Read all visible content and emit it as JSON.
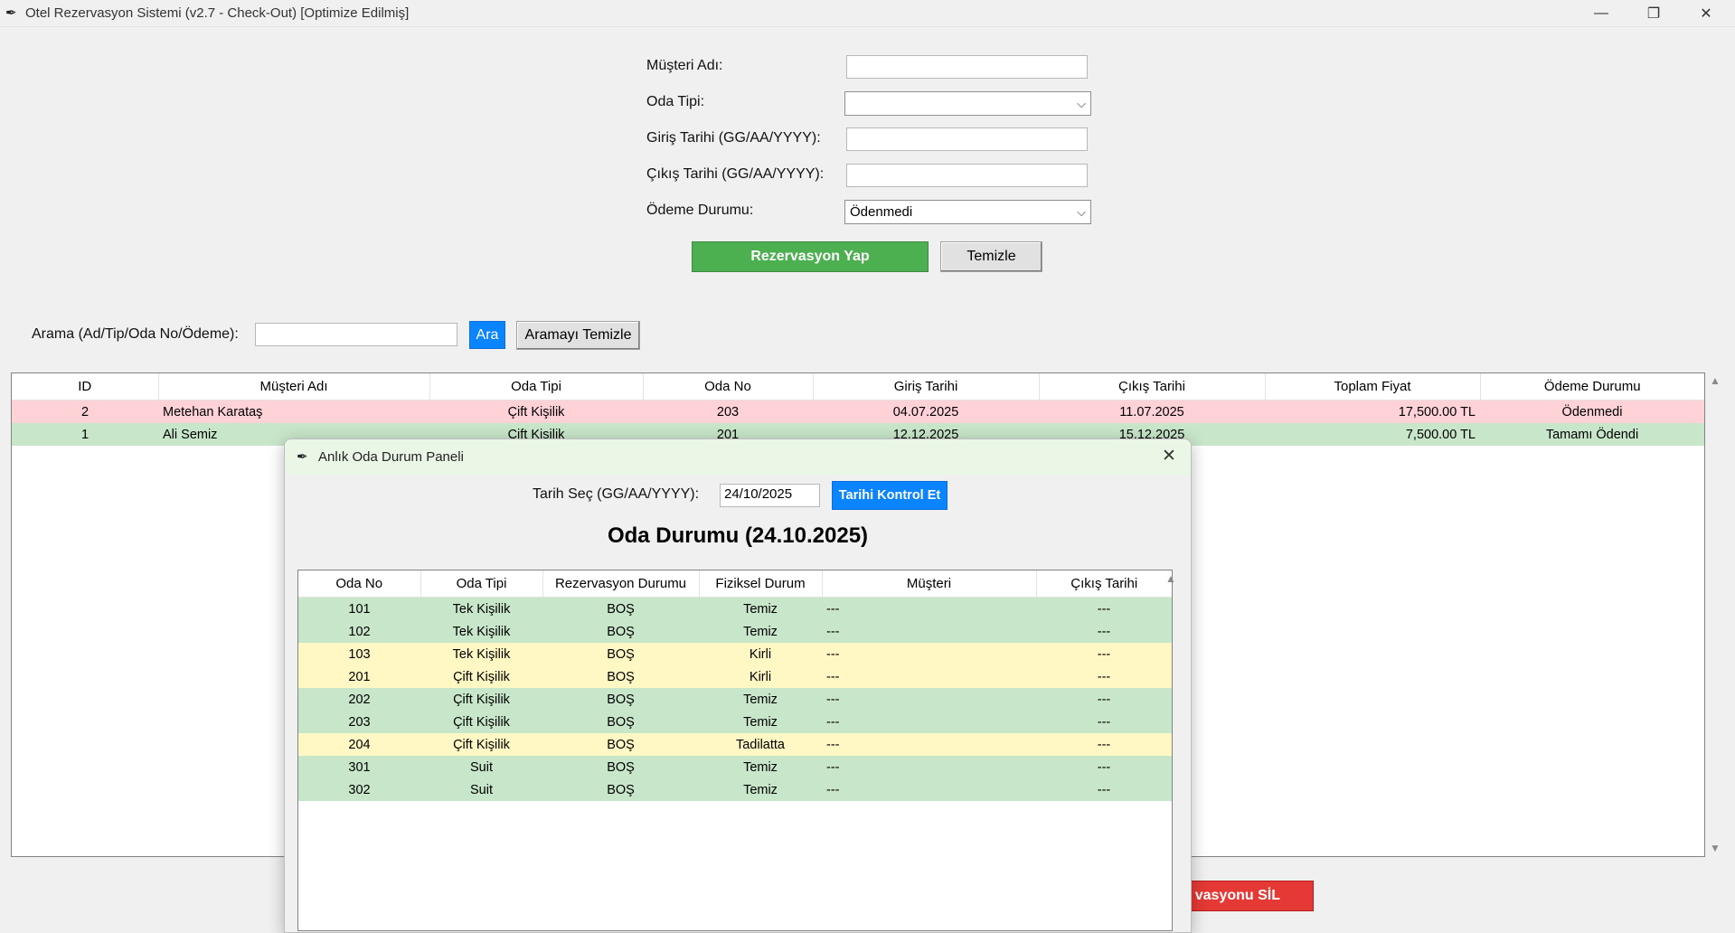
{
  "window": {
    "title": "Otel Rezervasyon Sistemi (v2.7 - Check-Out) [Optimize Edilmiş]",
    "minimize_glyph": "—",
    "maximize_glyph": "❐",
    "close_glyph": "✕"
  },
  "form": {
    "customer_name_label": "Müşteri Adı:",
    "customer_name_value": "",
    "room_type_label": "Oda Tipi:",
    "room_type_value": "",
    "checkin_label": "Giriş Tarihi (GG/AA/YYYY):",
    "checkin_value": "",
    "checkout_label": "Çıkış Tarihi (GG/AA/YYYY):",
    "checkout_value": "",
    "payment_label": "Ödeme Durumu:",
    "payment_value": "Ödenmedi",
    "reserve_button": "Rezervasyon Yap",
    "clear_button": "Temizle"
  },
  "search": {
    "label": "Arama (Ad/Tip/Oda No/Ödeme):",
    "value": "",
    "search_button": "Ara",
    "clear_button": "Aramayı Temizle"
  },
  "reservations": {
    "headers": [
      "ID",
      "Müşteri Adı",
      "Oda Tipi",
      "Oda No",
      "Giriş Tarihi",
      "Çıkış Tarihi",
      "Toplam Fiyat",
      "Ödeme Durumu"
    ],
    "rows": [
      {
        "id": "2",
        "name": "Metehan Karataş",
        "type": "Çift Kişilik",
        "room": "203",
        "checkin": "04.07.2025",
        "checkout": "11.07.2025",
        "price": "17,500.00 TL",
        "payment": "Ödenmedi",
        "status": "unpaid"
      },
      {
        "id": "1",
        "name": "Ali Semiz",
        "type": "Çift Kişilik",
        "room": "201",
        "checkin": "12.12.2025",
        "checkout": "15.12.2025",
        "price": "7,500.00 TL",
        "payment": "Tamamı Ödendi",
        "status": "paid"
      }
    ]
  },
  "delete_button": "vasyonu SİL",
  "colors": {
    "accent_green": "#4caf50",
    "accent_blue": "#0a84ff",
    "delete_red": "#e53935",
    "row_pink": "#ffd2d8",
    "row_green": "#c8e6c9",
    "row_yellow": "#fff7c4"
  },
  "panel": {
    "title": "Anlık Oda Durum Paneli",
    "date_label": "Tarih Seç (GG/AA/YYYY):",
    "date_value": "24/10/2025",
    "check_button": "Tarihi Kontrol Et",
    "heading": "Oda Durumu (24.10.2025)",
    "headers": [
      "Oda No",
      "Oda Tipi",
      "Rezervasyon Durumu",
      "Fiziksel Durum",
      "Müşteri",
      "Çıkış Tarihi"
    ],
    "rows": [
      {
        "room": "101",
        "type": "Tek Kişilik",
        "res": "BOŞ",
        "phys": "Temiz",
        "customer": "---",
        "checkout": "---",
        "color": "green"
      },
      {
        "room": "102",
        "type": "Tek Kişilik",
        "res": "BOŞ",
        "phys": "Temiz",
        "customer": "---",
        "checkout": "---",
        "color": "green"
      },
      {
        "room": "103",
        "type": "Tek Kişilik",
        "res": "BOŞ",
        "phys": "Kirli",
        "customer": "---",
        "checkout": "---",
        "color": "yellow"
      },
      {
        "room": "201",
        "type": "Çift Kişilik",
        "res": "BOŞ",
        "phys": "Kirli",
        "customer": "---",
        "checkout": "---",
        "color": "yellow"
      },
      {
        "room": "202",
        "type": "Çift Kişilik",
        "res": "BOŞ",
        "phys": "Temiz",
        "customer": "---",
        "checkout": "---",
        "color": "green"
      },
      {
        "room": "203",
        "type": "Çift Kişilik",
        "res": "BOŞ",
        "phys": "Temiz",
        "customer": "---",
        "checkout": "---",
        "color": "green"
      },
      {
        "room": "204",
        "type": "Çift Kişilik",
        "res": "BOŞ",
        "phys": "Tadilatta",
        "customer": "---",
        "checkout": "---",
        "color": "yellow"
      },
      {
        "room": "301",
        "type": "Suit",
        "res": "BOŞ",
        "phys": "Temiz",
        "customer": "---",
        "checkout": "---",
        "color": "green"
      },
      {
        "room": "302",
        "type": "Suit",
        "res": "BOŞ",
        "phys": "Temiz",
        "customer": "---",
        "checkout": "---",
        "color": "green"
      }
    ]
  }
}
